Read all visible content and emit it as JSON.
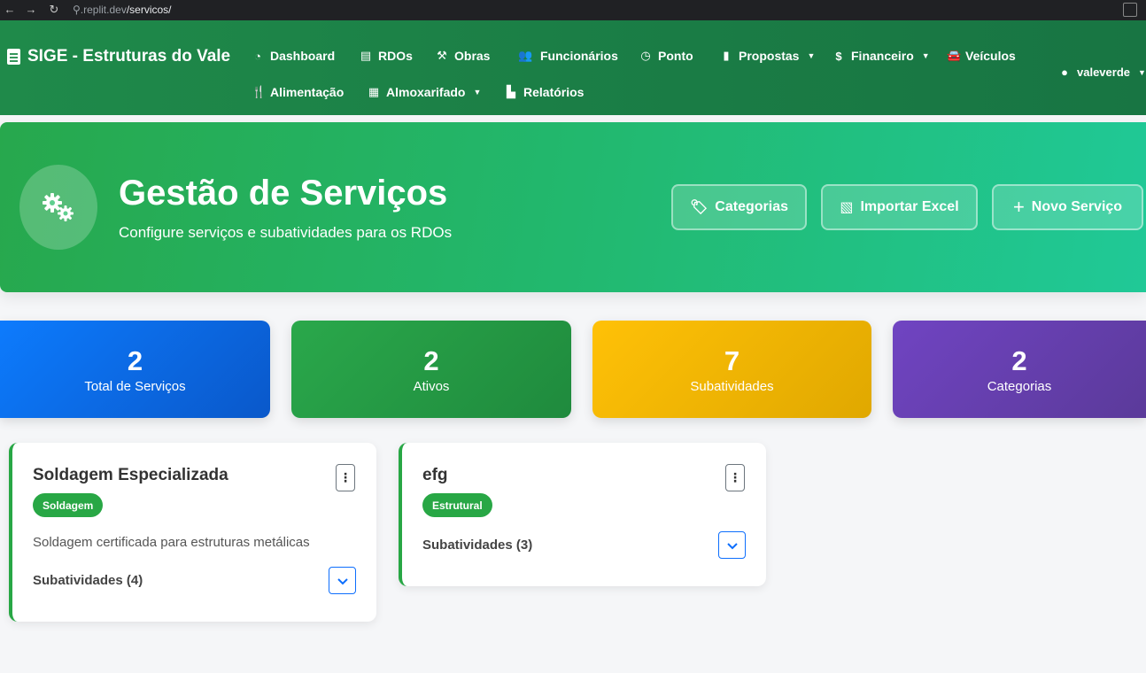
{
  "browser": {
    "url_host": ".replit.dev",
    "url_path": "/servicos/"
  },
  "navbar": {
    "brand": "SIGE - Estruturas do Vale",
    "items": [
      {
        "label": "Dashboard",
        "icon": "gauge-icon"
      },
      {
        "label": "RDOs",
        "icon": "clipboard-icon"
      },
      {
        "label": "Obras",
        "icon": "hammer-icon"
      },
      {
        "label": "Funcionários",
        "icon": "users-icon"
      },
      {
        "label": "Ponto",
        "icon": "clock-icon"
      },
      {
        "label": "Propostas",
        "icon": "file-icon",
        "dropdown": true
      },
      {
        "label": "Financeiro",
        "icon": "dollar-icon",
        "dropdown": true
      },
      {
        "label": "Veículos",
        "icon": "car-icon"
      },
      {
        "label": "Alimentação",
        "icon": "utensils-icon"
      },
      {
        "label": "Almoxarifado",
        "icon": "boxes-icon",
        "dropdown": true
      },
      {
        "label": "Relatórios",
        "icon": "chart-icon"
      }
    ],
    "user": "valeverde"
  },
  "hero": {
    "title": "Gestão de Serviços",
    "subtitle": "Configure serviços e subatividades para os RDOs",
    "buttons": {
      "categorias": "Categorias",
      "importar": "Importar Excel",
      "novo": "Novo Serviço"
    }
  },
  "stats": [
    {
      "value": "2",
      "label": "Total de Serviços",
      "color": "#0d6efd"
    },
    {
      "value": "2",
      "label": "Ativos",
      "color": "#28a745"
    },
    {
      "value": "7",
      "label": "Subatividades",
      "color": "#ffc107"
    },
    {
      "value": "2",
      "label": "Categorias",
      "color": "#6f42c1"
    }
  ],
  "services": [
    {
      "title": "Soldagem Especializada",
      "badge": "Soldagem",
      "description": "Soldagem certificada para estruturas metálicas",
      "subactivities": "Subatividades (4)"
    },
    {
      "title": "efg",
      "badge": "Estrutural",
      "description": "",
      "subactivities": "Subatividades (3)"
    }
  ]
}
